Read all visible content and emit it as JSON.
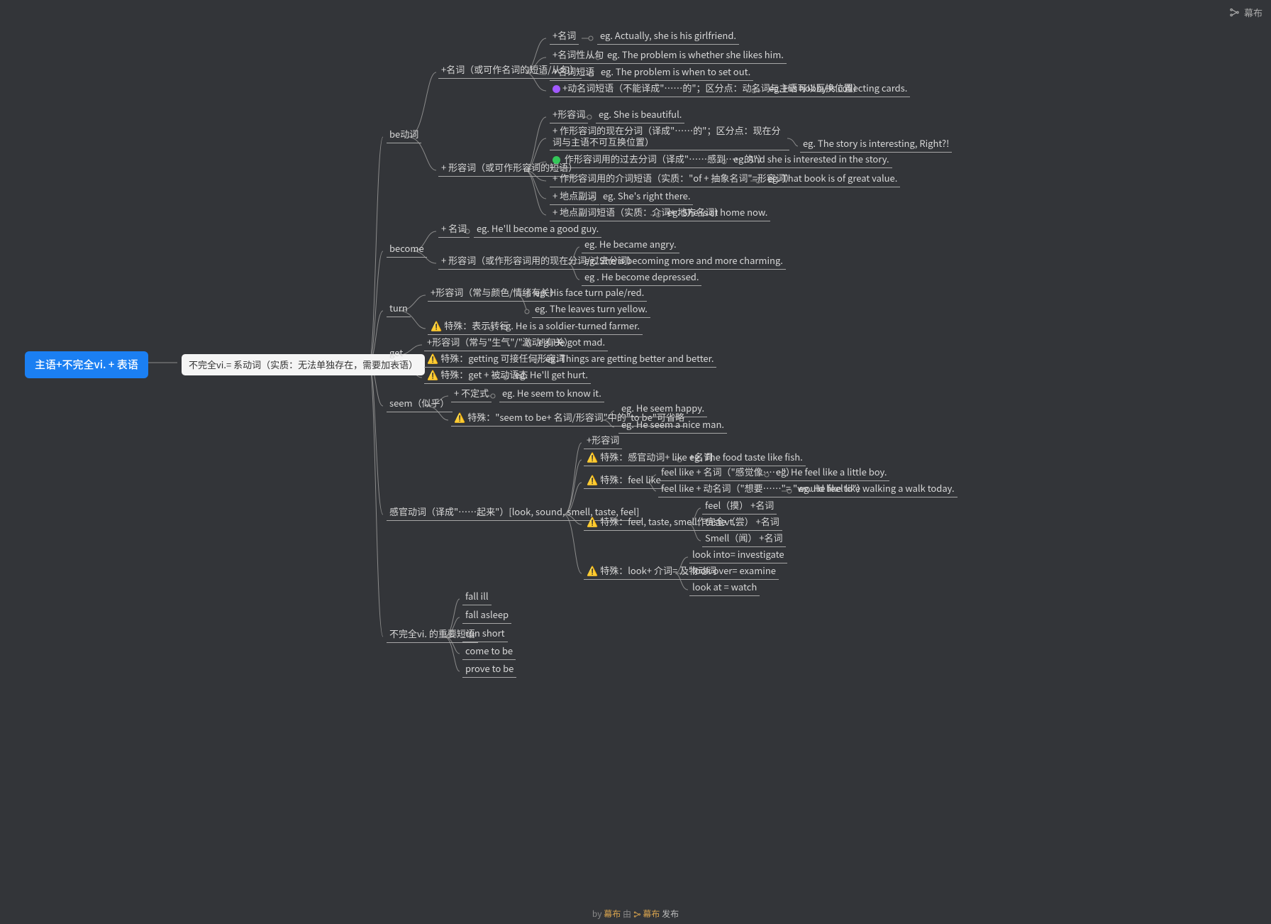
{
  "brand": "幕布",
  "footer": {
    "by": "by",
    "a": "幕布",
    "mid": "由",
    "b": "幕布",
    "pub": "发布"
  },
  "root": "主语+不完全vi. + 表语",
  "l1": "不完全vi.= 系动词（实质：无法单独存在，需要加表语）",
  "be": "be动词",
  "be1": "+名词（或可作名词的短语/从句）",
  "be1a": "+名词",
  "be1a_eg": "eg. Actually, she is his girlfriend.",
  "be1b": "+名词性从句",
  "be1b_eg": "eg. The problem is whether she likes him.",
  "be1c": "+名词短语",
  "be1c_eg": "eg. The problem is when to set out.",
  "be1d": "+动名词短语（不能译成\"……的\"；区分点：动名词与主语可以互换位置）",
  "be1d_eg": "eg. His hobby is collecting cards.",
  "be2": "+ 形容词（或可作形容词的短语）",
  "be2a": "+形容词",
  "be2a_eg": "eg. She is beautiful.",
  "be2b": "+ 作形容词的现在分词（译成\"……的\"；区分点：现在分词与主语不可互换位置）",
  "be2b_eg": "eg. The story is interesting, Right?!",
  "be2c": " 作形容词用的过去分词（译成\"……感到……的\"）",
  "be2c_eg": "eg. And she is interested in the story.",
  "be2d": "+ 作形容词用的介词短语（实质：\"of + 抽象名词\"=形容词）",
  "be2d_eg": "eg. That book is of great value.",
  "be2e": "+ 地点副词",
  "be2e_eg": "eg. She's right there.",
  "be2f": "+ 地点副词短语（实质：介词+ 地方名词）",
  "be2f_eg": "eg. She is at home now.",
  "become": "become",
  "bc1": "+ 名词",
  "bc1_eg": "eg. He'll become a good guy.",
  "bc2": "+ 形容词（或作形容词用的现在分词/过去分词）",
  "bc2a": "eg. He became angry.",
  "bc2b": "eg. She is becoming more and more charming.",
  "bc2c": "eg . He become depressed.",
  "turn": "turn",
  "tu1": "+形容词（常与颜色/情绪有关）",
  "tu1a": "eg. His face turn pale/red.",
  "tu1b": "eg. The leaves turn yellow.",
  "tu2": "特殊：表示转行",
  "tu2_eg": "eg. He is a soldier-turned farmer.",
  "get": "get",
  "g1": "+形容词（常与\"生气\"/\"激动\"有关）",
  "g1_eg": "eg. He got mad.",
  "g2": "特殊：getting 可接任何形容词",
  "g2_eg": "eg. Things are getting better and better.",
  "g3": "特殊：get + 被动语态",
  "g3_eg": "eg. He'll get hurt.",
  "seem": "seem（似乎）",
  "s1": "+ 不定式",
  "s1_eg": "eg. He seem to know it.",
  "s2": "特殊：\"seem to be+ 名词/形容词\"中的\"to be\"可省略",
  "s2a": "eg. He seem happy.",
  "s2b": "eg. He seem a nice man.",
  "sense": "感官动词（译成\"……起来\"）[look, sound, smell, taste, feel]",
  "se1": "+形容词",
  "se2": "特殊：感官动词+ like +名词",
  "se2_eg": "eg. The food taste like fish.",
  "se3": "特殊：feel like",
  "se3a": "feel like + 名词（\"感觉像……\"）",
  "se3a_eg": "eg. He feel like a little boy.",
  "se3b": "feel like + 动名词（\"想要……\"= \"would like to\"）",
  "se3b_eg": "eg. He feel like walking a walk today.",
  "se4": "特殊：feel, taste, smell作完全vt.",
  "se4a": "feel（摸） +名词",
  "se4b": "taste（尝） +名词",
  "se4c": "Smell（闻） +名词",
  "se5": "特殊：look+ 介词= 及物动词",
  "se5a": "look into= investigate",
  "se5b": "look over= examine",
  "se5c": "look at = watch",
  "phr": "不完全vi. 的重要短语",
  "p1": "fall ill",
  "p2": "fall asleep",
  "p3": "run short",
  "p4": "come to be",
  "p5": "prove to be"
}
